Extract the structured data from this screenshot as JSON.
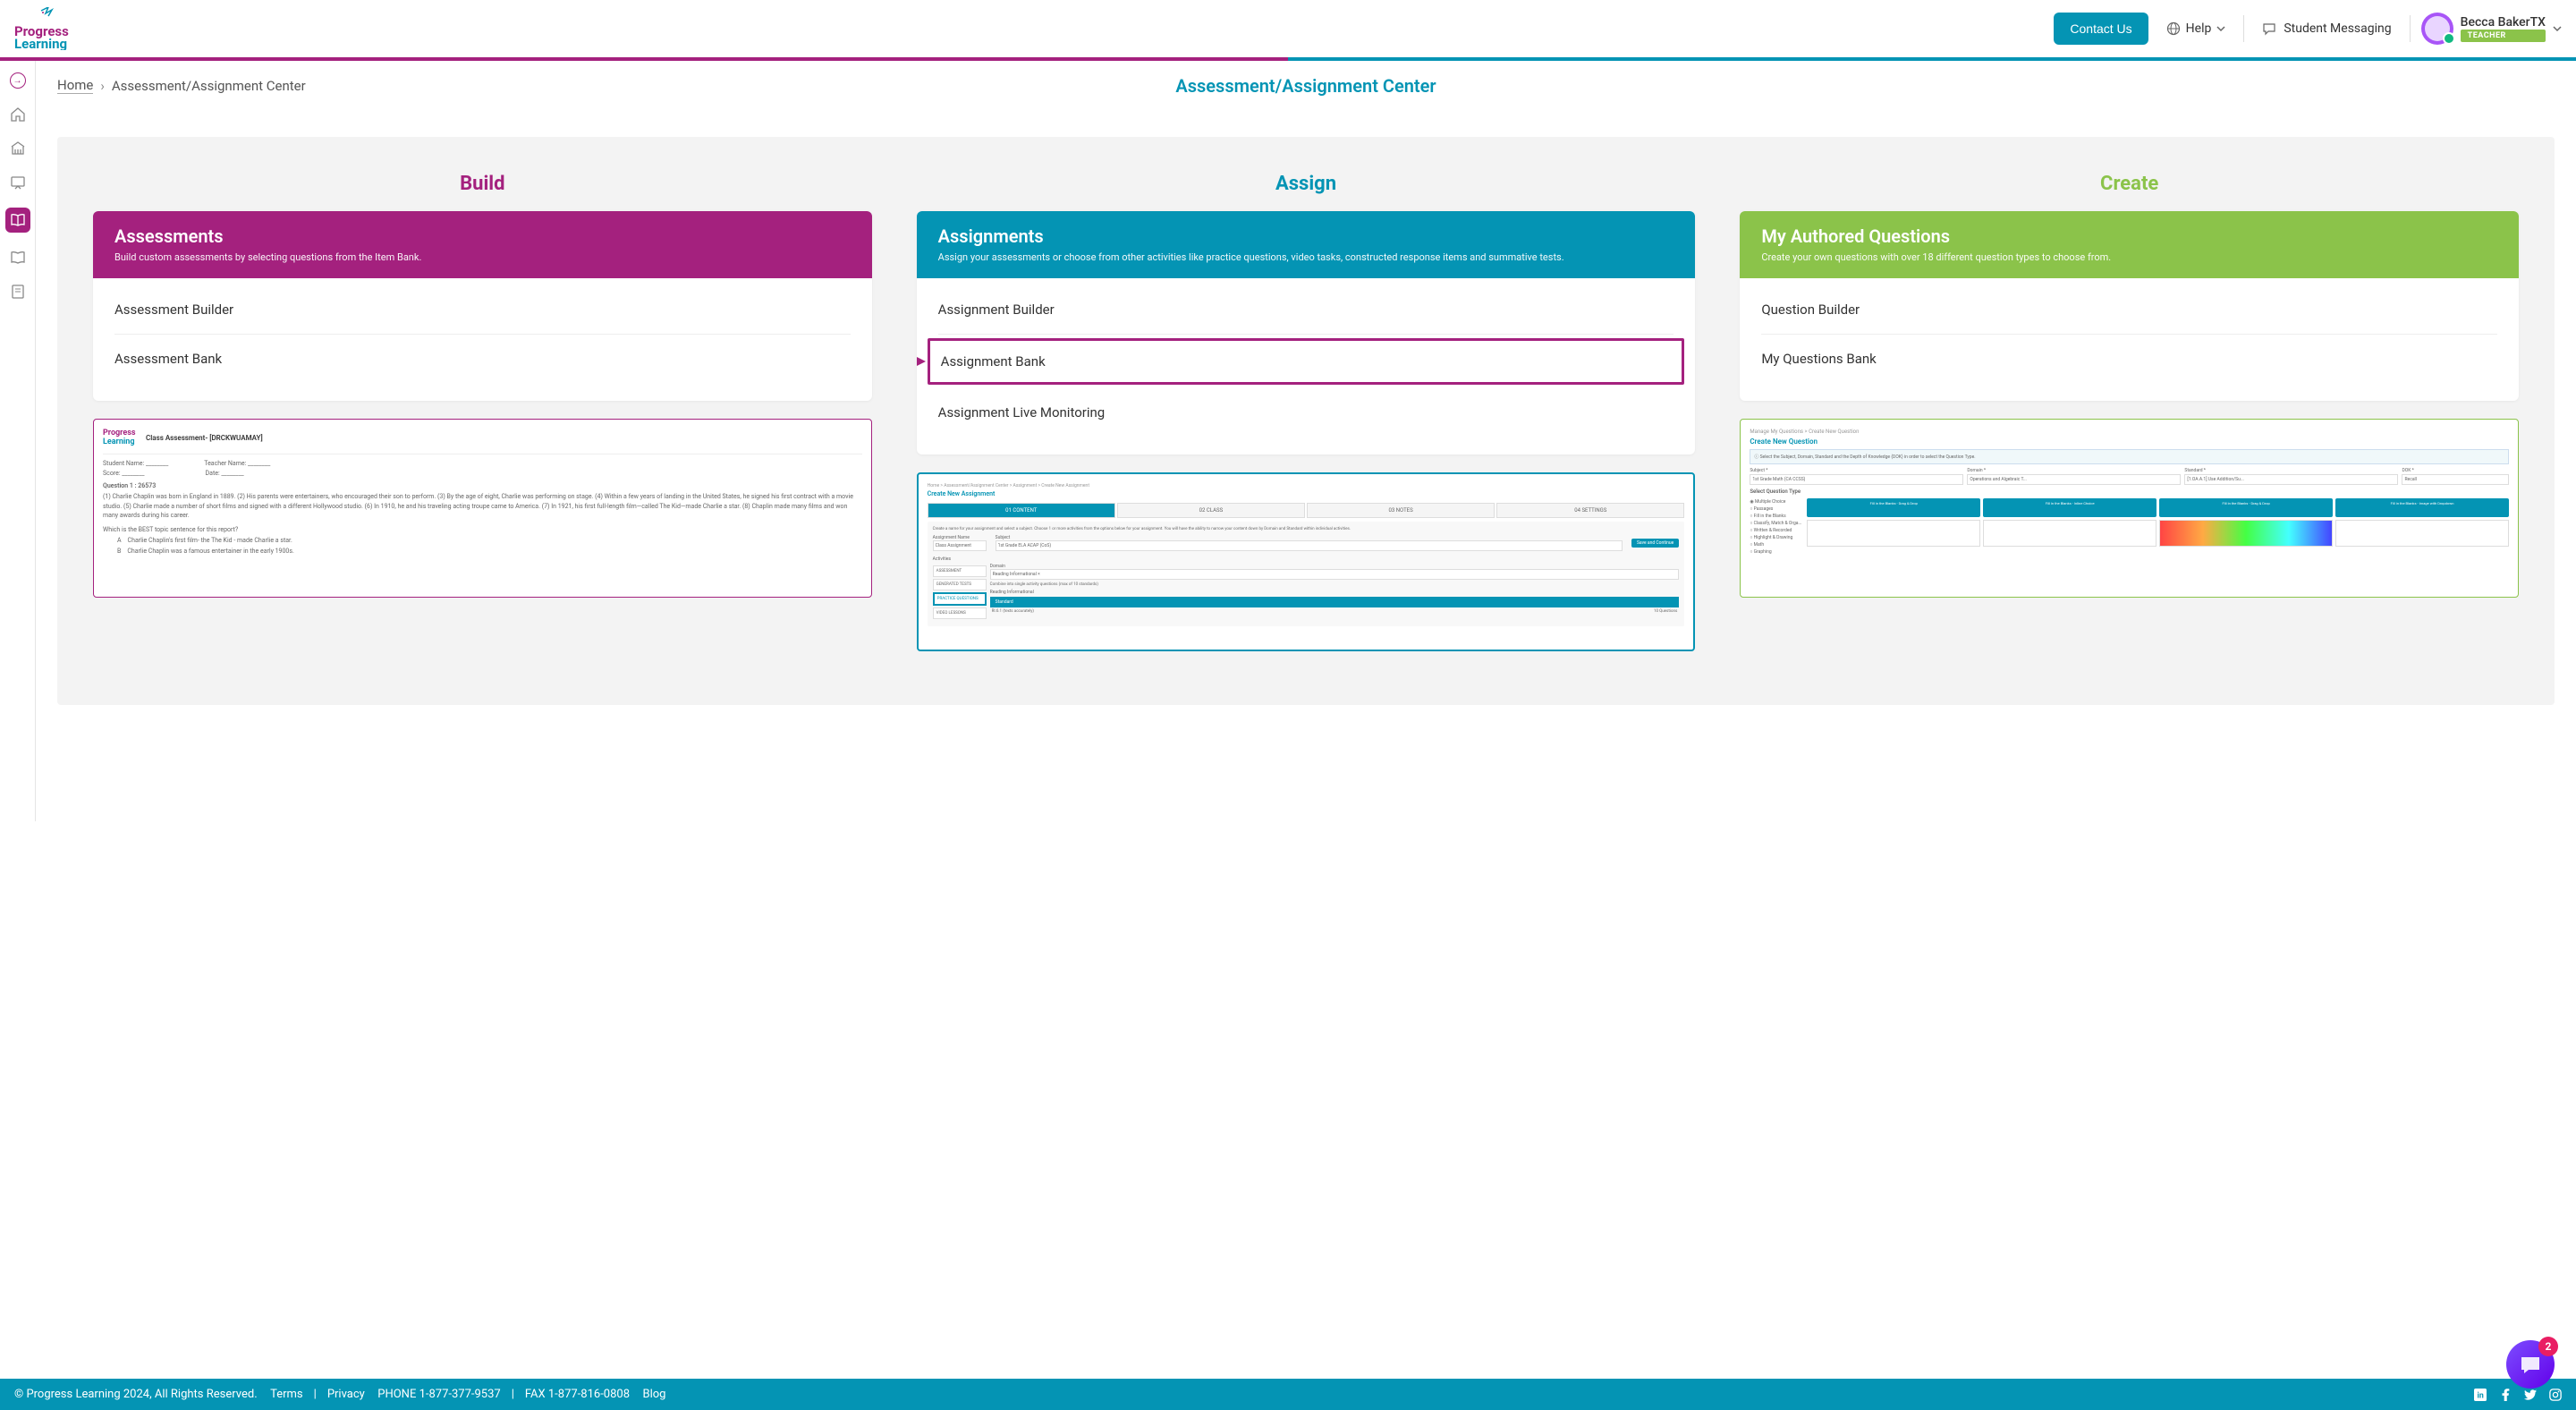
{
  "header": {
    "contact_button": "Contact Us",
    "help_label": "Help",
    "messaging_label": "Student Messaging",
    "user_name": "Becca BakerTX",
    "user_role": "TEACHER"
  },
  "breadcrumb": {
    "home": "Home",
    "current": "Assessment/Assignment Center"
  },
  "page_title": "Assessment/Assignment Center",
  "columns": {
    "build": {
      "title": "Build",
      "card_title": "Assessments",
      "card_desc": "Build custom assessments by selecting questions from the Item Bank.",
      "links": [
        "Assessment Builder",
        "Assessment Bank"
      ]
    },
    "assign": {
      "title": "Assign",
      "card_title": "Assignments",
      "card_desc": "Assign your assessments or choose from other activities like practice questions, video tasks, constructed response items and summative tests.",
      "links": [
        "Assignment Builder",
        "Assignment Bank",
        "Assignment Live Monitoring"
      ]
    },
    "create": {
      "title": "Create",
      "card_title": "My Authored Questions",
      "card_desc": "Create your own questions with over 18 different question types to choose from.",
      "links": [
        "Question Builder",
        "My Questions Bank"
      ]
    }
  },
  "preview_build": {
    "title_label": "Class Assessment- [DRCKWUAMAY]",
    "student_label": "Student Name:",
    "teacher_label": "Teacher Name:",
    "score_label": "Score:",
    "date_label": "Date:",
    "question_label": "Question 1 : 26573",
    "passage": "(1) Charlie Chaplin was born in England in 1889. (2) His parents were entertainers, who encouraged their son to perform. (3) By the age of eight, Charlie was performing on stage. (4) Within a few years of landing in the United States, he signed his first contract with a movie studio. (5) Charlie made a number of short films and signed with a different Hollywood studio. (6) In 1910, he and his traveling acting troupe came to America. (7) In 1921, his first full-length film—called The Kid—made Charlie a star. (8) Chaplin made many films and won many awards during his career.",
    "prompt": "Which is the BEST topic sentence for this report?",
    "option_a_letter": "A",
    "option_a": "Charlie Chaplin's first film- the The Kid - made Charlie a star.",
    "option_b_letter": "B",
    "option_b": "Charlie Chaplin was a famous entertainer in the early 1900s."
  },
  "preview_assign": {
    "breadcrumb": "Home > Assessment/Assignment Center > Assignment > Create New Assignment",
    "title": "Create New Assignment",
    "tabs": [
      "01 CONTENT",
      "02 CLASS",
      "03 NOTES",
      "04 SETTINGS"
    ],
    "info": "Create a name for your assignment and select a subject. Choose 1 or more activities from the options below for your assignment. You will have the ability to narrow your content down by Domain and Standard within individual activities.",
    "name_label": "Assignment Name",
    "name_value": "Class Assignment",
    "subject_label": "Subject",
    "subject_value": "1st Grade ELA ACAP (CoS)",
    "save_btn": "Save and Continue",
    "activities_label": "Activities",
    "items": [
      "ASSESSMENT",
      "GENERATED TESTS",
      "PRACTICE QUESTIONS",
      "VIDEO LESSONS"
    ],
    "domain_label": "Domain",
    "domain_value": "Reading Informational ×",
    "combine_label": "Combine into single activity questions (max of 10 standards)",
    "standard_group": "Reading Informational",
    "standard_label": "Standard",
    "standard_value": "RI.6.1 (texts accurately)",
    "question_count": "10 Questions"
  },
  "preview_create": {
    "breadcrumb": "Manage My Questions > Create New Question",
    "title": "Create New Question",
    "info": "Select the Subject, Domain, Standard and the Depth of Knowledge (DOK) in order to select the Question Type.",
    "subject_label": "Subject *",
    "subject_value": "1st Grade Math (CA CCSS)",
    "domain_label": "Domain *",
    "domain_value": "Operations and Algebraic T...",
    "standard_label": "Standard *",
    "standard_value": "[1.OA.A.1] Use Addition/Su...",
    "dok_label": "DOK *",
    "dok_value": "Recall",
    "select_qt_label": "Select Question Type",
    "types": [
      "Multiple Choice",
      "Passages",
      "Fill in the Blanks",
      "Classify, Match & Orga...",
      "Written & Recorded",
      "Highlight & Drawing",
      "Math",
      "Graphing"
    ],
    "tiles": [
      "Fill in the Blanks - Drag & Drop",
      "Fill in the Blanks - Inline Choice",
      "Fill in the Blanks - Drag & Drop",
      "Fill in the Blanks - Image with Dropdown"
    ]
  },
  "footer": {
    "copyright": "© Progress Learning 2024, All Rights Reserved.",
    "terms": "Terms",
    "privacy": "Privacy",
    "phone": "PHONE 1-877-377-9537",
    "fax": "FAX 1-877-816-0808",
    "blog": "Blog"
  },
  "chat_badge": "2"
}
